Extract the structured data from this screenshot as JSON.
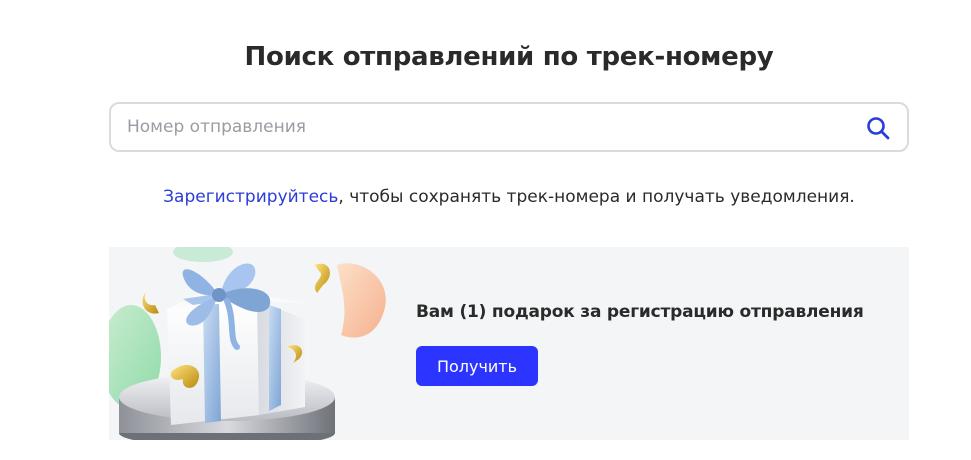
{
  "header": {
    "title": "Поиск отправлений по трек-номеру"
  },
  "search": {
    "placeholder": "Номер отправления",
    "value": "",
    "icon": "search-icon",
    "icon_color": "#2a3dd6"
  },
  "register": {
    "link_label": "Зарегистрируйтесь",
    "rest_text": ", чтобы сохранять трек-номера и получать уведомления.",
    "link_color": "#2a3dd6"
  },
  "promo": {
    "text": "Вам (1) подарок за регистрацию отправления",
    "button_label": "Получить",
    "button_color": "#2b35ff",
    "background": "#f4f5f7",
    "illustration": "gift-box-illustration"
  }
}
